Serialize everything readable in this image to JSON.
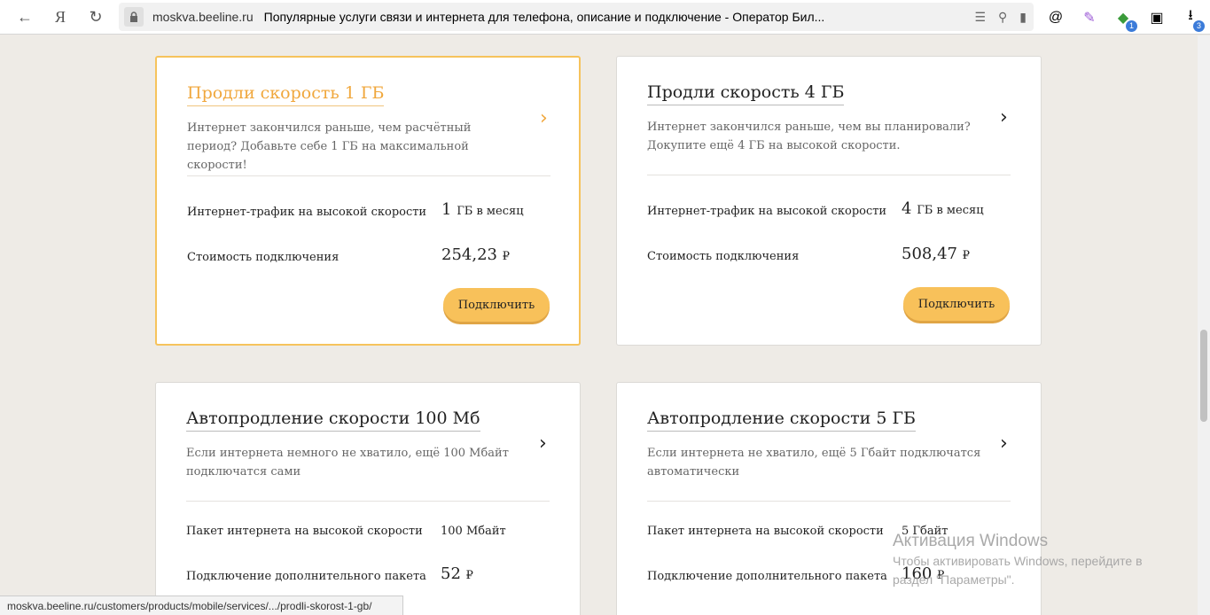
{
  "browser": {
    "back_icon": "←",
    "yandex_logo": "Я",
    "reload_icon": "↻",
    "domain": "moskva.beeline.ru",
    "page_title": "Популярные услуги связи и интернета для телефона, описание и подключение - Оператор Бил...",
    "extension_badge_1": "1",
    "extension_badge_2": "3"
  },
  "cards": [
    {
      "title": "Продли скорость 1 ГБ",
      "description": "Интернет закончился раньше, чем расчётный период? Добавьте себе 1 ГБ на максимальной скорости!",
      "rows": [
        {
          "label": "Интернет-трафик на высокой скорости",
          "value": "1",
          "unit": "ГБ в месяц"
        },
        {
          "label": "Стоимость подключения",
          "value": "254,23",
          "unit": "₽"
        }
      ],
      "button": "Подключить"
    },
    {
      "title": "Продли скорость 4 ГБ",
      "description": "Интернет закончился раньше, чем вы планировали? Докупите ещё 4 ГБ на высокой скорости.",
      "rows": [
        {
          "label": "Интернет-трафик на высокой скорости",
          "value": "4",
          "unit": "ГБ в месяц"
        },
        {
          "label": "Стоимость подключения",
          "value": "508,47",
          "unit": "₽"
        }
      ],
      "button": "Подключить"
    },
    {
      "title": "Автопродление скорости 100 Мб",
      "description": "Если интернета немного не хватило, ещё 100 Мбайт подключатся сами",
      "rows": [
        {
          "label": "Пакет интернета на высокой скорости",
          "value": "100 Мбайт"
        },
        {
          "label": "Подключение дополнительного пакета",
          "value": "52",
          "unit": "₽"
        }
      ]
    },
    {
      "title": "Автопродление скорости 5 ГБ",
      "description": "Если интернета не хватило, ещё 5 Гбайт подключатся автоматически",
      "rows": [
        {
          "label": "Пакет интернета на высокой скорости",
          "value": "5 Гбайт"
        },
        {
          "label": "Подключение дополнительного пакета",
          "value": "160",
          "unit": "₽"
        }
      ]
    }
  ],
  "status_url": "moskva.beeline.ru/customers/products/mobile/services/.../prodli-skorost-1-gb/",
  "watermark": {
    "heading": "Активация Windows",
    "line1": "Чтобы активировать Windows, перейдите в",
    "line2": "раздел \"Параметры\"."
  }
}
